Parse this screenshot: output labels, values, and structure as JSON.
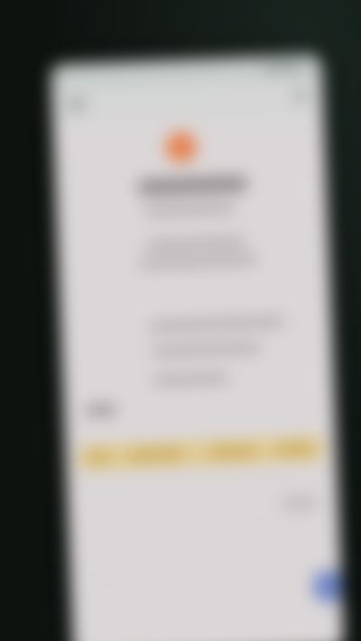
{
  "screen": {
    "background": "#dbd7d8",
    "accent_logo_color": "#e7814d",
    "highlight_color": "#e0c98e",
    "fab_color": "#6f86c7"
  },
  "icons": {
    "back": "back-arrow-icon",
    "menu": "more-menu-icon",
    "logo": "app-logo-icon",
    "fab": "floating-action-icon"
  }
}
